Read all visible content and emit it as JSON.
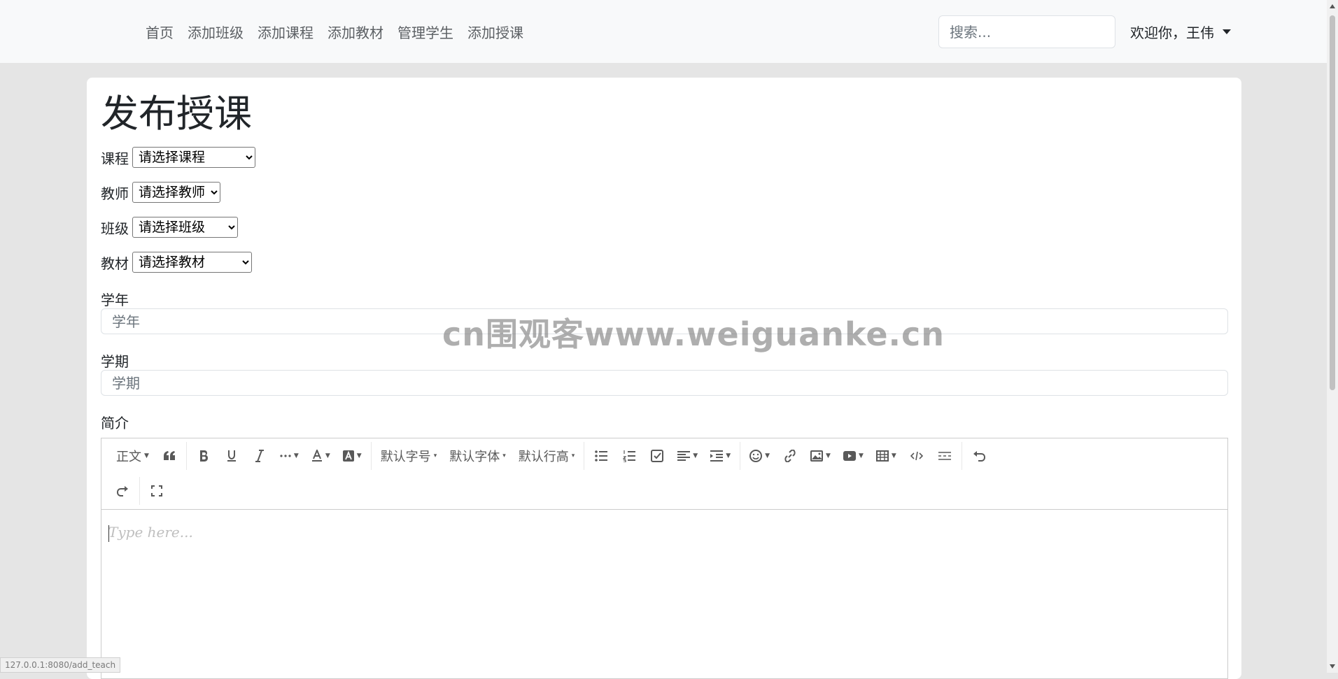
{
  "nav": {
    "links": [
      "首页",
      "添加班级",
      "添加课程",
      "添加教材",
      "管理学生",
      "添加授课"
    ],
    "search_placeholder": "搜索...",
    "user_label": "欢迎你，王伟"
  },
  "form": {
    "title": "发布授课",
    "course_label": "课程",
    "course_selected": "请选择课程",
    "teacher_label": "教师",
    "teacher_selected": "请选择教师",
    "class_label": "班级",
    "class_selected": "请选择班级",
    "textbook_label": "教材",
    "textbook_selected": "请选择教材",
    "year_label": "学年",
    "year_placeholder": "学年",
    "term_label": "学期",
    "term_placeholder": "学期",
    "intro_label": "简介"
  },
  "editor": {
    "toolbar": {
      "paragraph": "正文",
      "font_size": "默认字号",
      "font_family": "默认字体",
      "line_height": "默认行高"
    },
    "placeholder": "Type here..."
  },
  "watermark": "cn围观客www.weiguanke.cn",
  "status_url": "127.0.0.1:8080/add_teach"
}
